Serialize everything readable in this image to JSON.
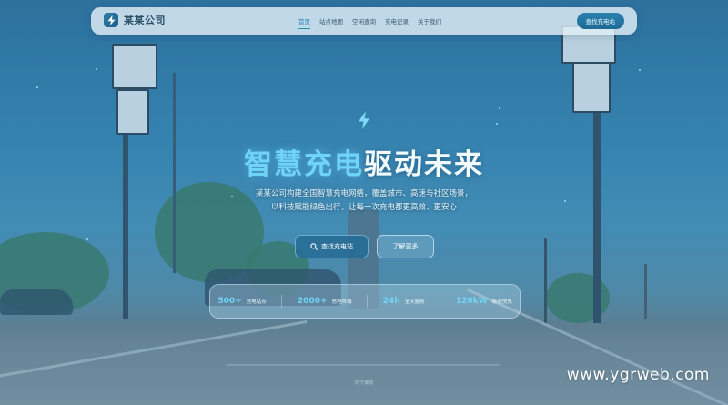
{
  "brand": {
    "name": "某某公司",
    "logo_icon": "bolt-icon"
  },
  "nav": {
    "items": [
      {
        "label": "首页",
        "active": true
      },
      {
        "label": "站点地图",
        "active": false
      },
      {
        "label": "空闲查询",
        "active": false
      },
      {
        "label": "充电记录",
        "active": false
      },
      {
        "label": "关于我们",
        "active": false
      }
    ],
    "cta_label": "查找充电站"
  },
  "hero": {
    "icon": "bolt-icon",
    "headline_part1": "智慧充电",
    "headline_part2": "驱动未来",
    "description_line1": "某某公司构建全国智慧充电网络，覆盖城市、高速与社区场景，",
    "description_line2": "以科技赋能绿色出行，让每一次充电都更高效、更安心",
    "primary_button": "查找充电站",
    "primary_button_icon": "search-icon",
    "secondary_button": "了解更多"
  },
  "stats": [
    {
      "value": "500+",
      "label": "充电站点"
    },
    {
      "value": "2000+",
      "label": "充电终端"
    },
    {
      "value": "24h",
      "label": "全天服务"
    },
    {
      "value": "120kW",
      "label": "极速快充"
    }
  ],
  "scroll_hint": "向下滚动",
  "watermark": "www.ygrweb.com",
  "colors": {
    "accent": "#6fd4f6",
    "primary": "#2a82ad",
    "nav_active": "#2b88b8"
  }
}
